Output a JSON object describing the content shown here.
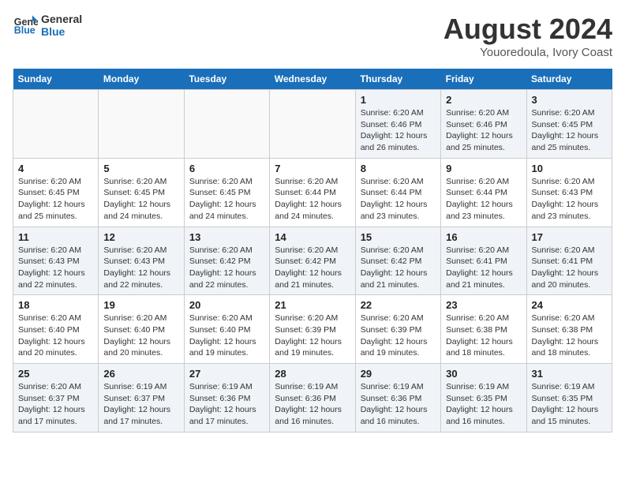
{
  "header": {
    "logo_line1": "General",
    "logo_line2": "Blue",
    "title": "August 2024",
    "subtitle": "Youoredoula, Ivory Coast"
  },
  "days_of_week": [
    "Sunday",
    "Monday",
    "Tuesday",
    "Wednesday",
    "Thursday",
    "Friday",
    "Saturday"
  ],
  "weeks": [
    [
      {
        "day": "",
        "info": ""
      },
      {
        "day": "",
        "info": ""
      },
      {
        "day": "",
        "info": ""
      },
      {
        "day": "",
        "info": ""
      },
      {
        "day": "1",
        "info": "Sunrise: 6:20 AM\nSunset: 6:46 PM\nDaylight: 12 hours and 26 minutes."
      },
      {
        "day": "2",
        "info": "Sunrise: 6:20 AM\nSunset: 6:46 PM\nDaylight: 12 hours and 25 minutes."
      },
      {
        "day": "3",
        "info": "Sunrise: 6:20 AM\nSunset: 6:45 PM\nDaylight: 12 hours and 25 minutes."
      }
    ],
    [
      {
        "day": "4",
        "info": "Sunrise: 6:20 AM\nSunset: 6:45 PM\nDaylight: 12 hours and 25 minutes."
      },
      {
        "day": "5",
        "info": "Sunrise: 6:20 AM\nSunset: 6:45 PM\nDaylight: 12 hours and 24 minutes."
      },
      {
        "day": "6",
        "info": "Sunrise: 6:20 AM\nSunset: 6:45 PM\nDaylight: 12 hours and 24 minutes."
      },
      {
        "day": "7",
        "info": "Sunrise: 6:20 AM\nSunset: 6:44 PM\nDaylight: 12 hours and 24 minutes."
      },
      {
        "day": "8",
        "info": "Sunrise: 6:20 AM\nSunset: 6:44 PM\nDaylight: 12 hours and 23 minutes."
      },
      {
        "day": "9",
        "info": "Sunrise: 6:20 AM\nSunset: 6:44 PM\nDaylight: 12 hours and 23 minutes."
      },
      {
        "day": "10",
        "info": "Sunrise: 6:20 AM\nSunset: 6:43 PM\nDaylight: 12 hours and 23 minutes."
      }
    ],
    [
      {
        "day": "11",
        "info": "Sunrise: 6:20 AM\nSunset: 6:43 PM\nDaylight: 12 hours and 22 minutes."
      },
      {
        "day": "12",
        "info": "Sunrise: 6:20 AM\nSunset: 6:43 PM\nDaylight: 12 hours and 22 minutes."
      },
      {
        "day": "13",
        "info": "Sunrise: 6:20 AM\nSunset: 6:42 PM\nDaylight: 12 hours and 22 minutes."
      },
      {
        "day": "14",
        "info": "Sunrise: 6:20 AM\nSunset: 6:42 PM\nDaylight: 12 hours and 21 minutes."
      },
      {
        "day": "15",
        "info": "Sunrise: 6:20 AM\nSunset: 6:42 PM\nDaylight: 12 hours and 21 minutes."
      },
      {
        "day": "16",
        "info": "Sunrise: 6:20 AM\nSunset: 6:41 PM\nDaylight: 12 hours and 21 minutes."
      },
      {
        "day": "17",
        "info": "Sunrise: 6:20 AM\nSunset: 6:41 PM\nDaylight: 12 hours and 20 minutes."
      }
    ],
    [
      {
        "day": "18",
        "info": "Sunrise: 6:20 AM\nSunset: 6:40 PM\nDaylight: 12 hours and 20 minutes."
      },
      {
        "day": "19",
        "info": "Sunrise: 6:20 AM\nSunset: 6:40 PM\nDaylight: 12 hours and 20 minutes."
      },
      {
        "day": "20",
        "info": "Sunrise: 6:20 AM\nSunset: 6:40 PM\nDaylight: 12 hours and 19 minutes."
      },
      {
        "day": "21",
        "info": "Sunrise: 6:20 AM\nSunset: 6:39 PM\nDaylight: 12 hours and 19 minutes."
      },
      {
        "day": "22",
        "info": "Sunrise: 6:20 AM\nSunset: 6:39 PM\nDaylight: 12 hours and 19 minutes."
      },
      {
        "day": "23",
        "info": "Sunrise: 6:20 AM\nSunset: 6:38 PM\nDaylight: 12 hours and 18 minutes."
      },
      {
        "day": "24",
        "info": "Sunrise: 6:20 AM\nSunset: 6:38 PM\nDaylight: 12 hours and 18 minutes."
      }
    ],
    [
      {
        "day": "25",
        "info": "Sunrise: 6:20 AM\nSunset: 6:37 PM\nDaylight: 12 hours and 17 minutes."
      },
      {
        "day": "26",
        "info": "Sunrise: 6:19 AM\nSunset: 6:37 PM\nDaylight: 12 hours and 17 minutes."
      },
      {
        "day": "27",
        "info": "Sunrise: 6:19 AM\nSunset: 6:36 PM\nDaylight: 12 hours and 17 minutes."
      },
      {
        "day": "28",
        "info": "Sunrise: 6:19 AM\nSunset: 6:36 PM\nDaylight: 12 hours and 16 minutes."
      },
      {
        "day": "29",
        "info": "Sunrise: 6:19 AM\nSunset: 6:36 PM\nDaylight: 12 hours and 16 minutes."
      },
      {
        "day": "30",
        "info": "Sunrise: 6:19 AM\nSunset: 6:35 PM\nDaylight: 12 hours and 16 minutes."
      },
      {
        "day": "31",
        "info": "Sunrise: 6:19 AM\nSunset: 6:35 PM\nDaylight: 12 hours and 15 minutes."
      }
    ]
  ]
}
